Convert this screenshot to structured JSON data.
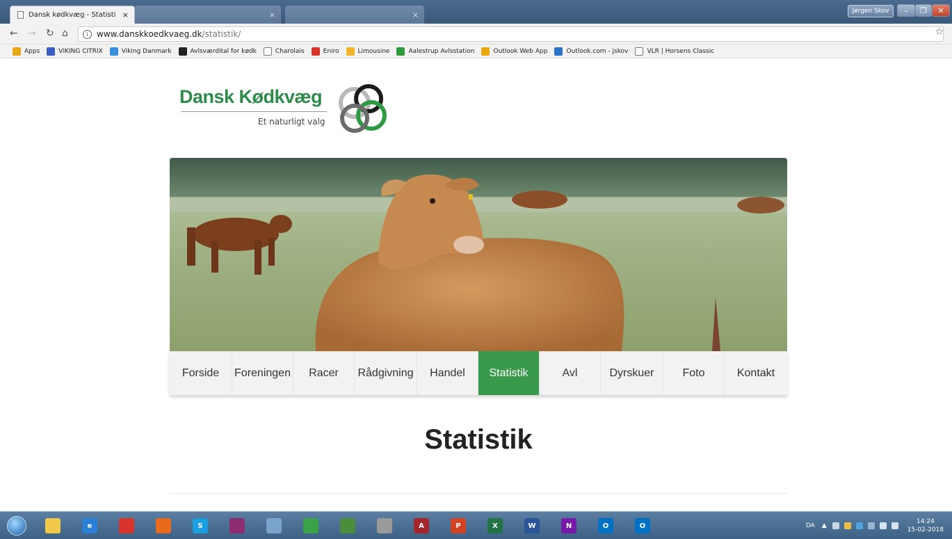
{
  "browser": {
    "tabs": [
      {
        "title": "Dansk kødkvæg - Statisti",
        "active": true
      },
      {
        "title": "",
        "active": false
      },
      {
        "title": "",
        "active": false
      }
    ],
    "window_user": "Jørgen Skov",
    "url_host": "www.danskkoedkvaeg.dk",
    "url_path": "/statistik/",
    "bookmarks": [
      {
        "label": "Apps",
        "icon": "apps-grid-icon",
        "color": "#e6a817"
      },
      {
        "label": "VIKING CITRIX",
        "icon": "citrix-icon",
        "color": "#3b5fc0"
      },
      {
        "label": "Viking Danmark",
        "icon": "globe-icon",
        "color": "#3b8fd8"
      },
      {
        "label": "Avlsværdital for kødk",
        "icon": "infinity-icon",
        "color": "#222222"
      },
      {
        "label": "Charolais",
        "icon": "page-icon",
        "color": "#ffffff"
      },
      {
        "label": "Eniro",
        "icon": "eniro-icon",
        "color": "#d9342b"
      },
      {
        "label": "Limousine",
        "icon": "folder-icon",
        "color": "#f0b52b"
      },
      {
        "label": "Aalestrup Avlsstation",
        "icon": "aalestrup-icon",
        "color": "#2f9a3c"
      },
      {
        "label": "Outlook Web App",
        "icon": "office-icon",
        "color": "#e8a90e"
      },
      {
        "label": "Outlook.com - jskov",
        "icon": "outlook-icon",
        "color": "#2a72c7"
      },
      {
        "label": "VLR | Horsens Classic",
        "icon": "page-icon",
        "color": "#ffffff"
      }
    ]
  },
  "site": {
    "logo_title": "Dansk Kødkvæg",
    "logo_subtitle": "Et naturligt valg",
    "menu": [
      {
        "label": "Forside",
        "active": false
      },
      {
        "label": "Foreningen",
        "active": false
      },
      {
        "label": "Racer",
        "active": false
      },
      {
        "label": "Rådgivning",
        "active": false
      },
      {
        "label": "Handel",
        "active": false
      },
      {
        "label": "Statistik",
        "active": true
      },
      {
        "label": "Avl",
        "active": false
      },
      {
        "label": "Dyrskuer",
        "active": false
      },
      {
        "label": "Foto",
        "active": false
      },
      {
        "label": "Kontakt",
        "active": false
      }
    ],
    "page_title": "Statistik",
    "accent_color": "#3a9a4c"
  },
  "taskbar": {
    "apps": [
      {
        "name": "explorer-icon",
        "label": "",
        "color": "#f0c84a"
      },
      {
        "name": "internet-explorer-icon",
        "label": "e",
        "color": "#2a7fd6"
      },
      {
        "name": "chrome-icon",
        "label": "",
        "color": "#d9342b"
      },
      {
        "name": "firefox-icon",
        "label": "",
        "color": "#e86a1c"
      },
      {
        "name": "skype-icon",
        "label": "S",
        "color": "#1aa0e0"
      },
      {
        "name": "winrar-icon",
        "label": "",
        "color": "#8c2d6f"
      },
      {
        "name": "photo-viewer-icon",
        "label": "",
        "color": "#7aa4cc"
      },
      {
        "name": "plant-app-icon",
        "label": "",
        "color": "#3aa34a"
      },
      {
        "name": "spreadsheet-app-icon",
        "label": "",
        "color": "#4a8d3a"
      },
      {
        "name": "spiral-app-icon",
        "label": "",
        "color": "#9a9a9a"
      },
      {
        "name": "access-icon",
        "label": "A",
        "color": "#a4262c"
      },
      {
        "name": "powerpoint-icon",
        "label": "P",
        "color": "#d04423"
      },
      {
        "name": "excel-icon",
        "label": "X",
        "color": "#217346"
      },
      {
        "name": "word-icon",
        "label": "W",
        "color": "#2b579a"
      },
      {
        "name": "onenote-icon",
        "label": "N",
        "color": "#7719aa"
      },
      {
        "name": "outlook-icon",
        "label": "O",
        "color": "#0072c6"
      },
      {
        "name": "outlook-2-icon",
        "label": "O",
        "color": "#0072c6"
      }
    ],
    "language": "DA",
    "time": "14:24",
    "date": "15-02-2018"
  }
}
